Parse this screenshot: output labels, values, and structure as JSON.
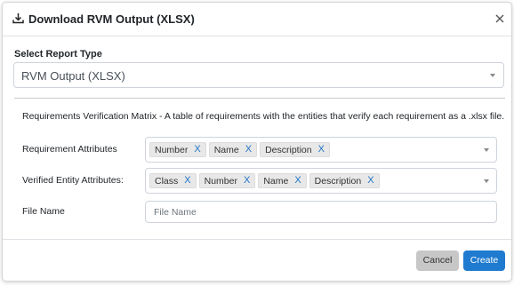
{
  "dialog": {
    "title": "Download RVM Output (XLSX)",
    "close_icon": "close-icon",
    "download_icon": "download-icon"
  },
  "report_type": {
    "label": "Select Report Type",
    "selected": "RVM Output (XLSX)"
  },
  "description": "Requirements Verification Matrix - A table of requirements with the entities that verify each requirement as a .xlsx file.",
  "requirement_attributes": {
    "label": "Requirement Attributes",
    "chips": [
      "Number",
      "Name",
      "Description"
    ]
  },
  "verified_entity_attributes": {
    "label": "Verified Entity Attributes:",
    "chips": [
      "Class",
      "Number",
      "Name",
      "Description"
    ]
  },
  "file_name": {
    "label": "File Name",
    "placeholder": "File Name",
    "value": ""
  },
  "footer": {
    "cancel_label": "Cancel",
    "create_label": "Create"
  },
  "chip_remove_label": "X",
  "colors": {
    "primary": "#1f7bd0",
    "secondary": "#c7c7c7",
    "chip_x": "#1f74c8"
  }
}
